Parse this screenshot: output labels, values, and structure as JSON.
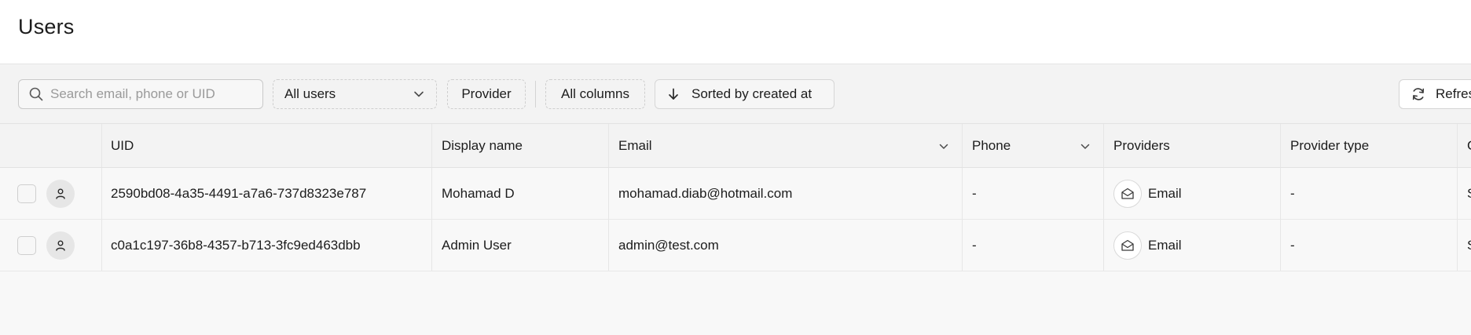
{
  "page": {
    "title": "Users"
  },
  "toolbar": {
    "search_placeholder": "Search email, phone or UID",
    "users_filter": "All users",
    "provider_label": "Provider",
    "columns_label": "All columns",
    "sort_label": "Sorted by created at",
    "refresh_label": "Refresh"
  },
  "table": {
    "headers": {
      "uid": "UID",
      "display_name": "Display name",
      "email": "Email",
      "phone": "Phone",
      "providers": "Providers",
      "provider_type": "Provider type",
      "extra": "C"
    },
    "rows": [
      {
        "uid": "2590bd08-4a35-4491-a7a6-737d8323e787",
        "display_name": "Mohamad D",
        "email": "mohamad.diab@hotmail.com",
        "phone": "-",
        "provider": "Email",
        "provider_type": "-",
        "extra": "S"
      },
      {
        "uid": "c0a1c197-36b8-4357-b713-3fc9ed463dbb",
        "display_name": "Admin User",
        "email": "admin@test.com",
        "phone": "-",
        "provider": "Email",
        "provider_type": "-",
        "extra": "S"
      }
    ]
  }
}
